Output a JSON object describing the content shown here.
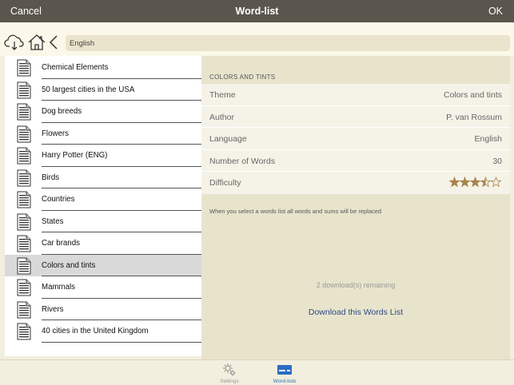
{
  "navbar": {
    "cancel_label": "Cancel",
    "title": "Word-list",
    "ok_label": "OK"
  },
  "toolbar": {
    "icons": [
      "cloud-download-icon",
      "home-icon",
      "chevron-left-icon"
    ],
    "path_value": "English"
  },
  "word_lists": {
    "items": [
      {
        "label": "Chemical Elements"
      },
      {
        "label": "50 largest cities in the USA"
      },
      {
        "label": "Dog breeds"
      },
      {
        "label": "Flowers"
      },
      {
        "label": "Harry Potter (ENG)"
      },
      {
        "label": "Birds"
      },
      {
        "label": "Countries"
      },
      {
        "label": "States"
      },
      {
        "label": "Car brands"
      },
      {
        "label": "Colors and tints"
      },
      {
        "label": "Mammals"
      },
      {
        "label": "Rivers"
      },
      {
        "label": "40 cities in the United Kingdom"
      }
    ],
    "selected_label": "Colors and tints",
    "item_icon": "document-icon"
  },
  "detail": {
    "section_header": "COLORS AND TINTS",
    "properties": [
      {
        "key": "Theme",
        "value": "Colors and tints"
      },
      {
        "key": "Author",
        "value": "P. van Rossum"
      },
      {
        "key": "Language",
        "value": "English"
      },
      {
        "key": "Number of Words",
        "value": "30"
      },
      {
        "key": "Difficulty",
        "value": ""
      }
    ],
    "difficulty": {
      "rating": 3.5,
      "max": 5,
      "color": "#a8834a"
    },
    "note": "When you select a words list all words and sums will be replaced",
    "remaining_text": "2 download(s) remaining",
    "download_label": "Download this Words List"
  },
  "tabbar": {
    "tabs": [
      {
        "label": "Settings",
        "icon": "gears-icon",
        "active": false
      },
      {
        "label": "Word-lists",
        "icon": "card-icon",
        "active": true
      }
    ],
    "active_color": "#2d6cc0"
  }
}
